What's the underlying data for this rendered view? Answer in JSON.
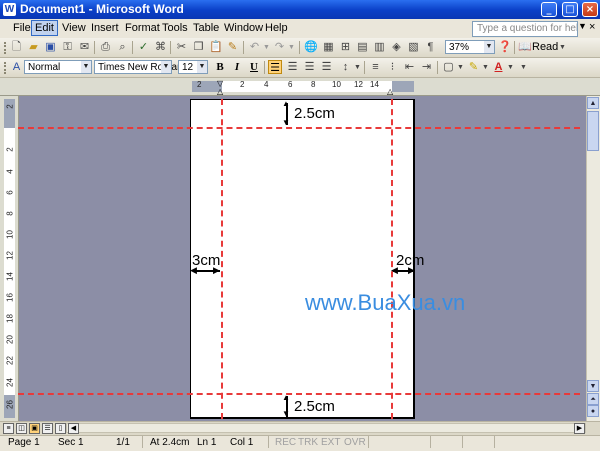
{
  "window": {
    "title": "Document1 - Microsoft Word",
    "app_icon": "W",
    "buttons": {
      "minimize": "_",
      "maximize": "□",
      "close": "×"
    }
  },
  "menu": {
    "items": [
      "File",
      "Edit",
      "View",
      "Insert",
      "Format",
      "Tools",
      "Table",
      "Window",
      "Help"
    ],
    "active": "Edit",
    "help_placeholder": "Type a question for help",
    "close": "×"
  },
  "toolbar_standard": {
    "zoom": "37%",
    "read_label": "Read"
  },
  "toolbar_formatting": {
    "style": "Normal",
    "font": "Times New Roman",
    "size": "12",
    "bold": "B",
    "italic": "I",
    "underline": "U",
    "font_color_label": "A"
  },
  "ruler": {
    "horizontal": [
      "2",
      "2",
      "4",
      "6",
      "8",
      "10",
      "12",
      "14"
    ],
    "vertical": [
      "2",
      "2",
      "4",
      "6",
      "8",
      "10",
      "12",
      "14",
      "16",
      "18",
      "20",
      "22",
      "24",
      "26"
    ]
  },
  "annotations": {
    "top_margin": "2.5cm",
    "bottom_margin": "2.5cm",
    "left_margin": "3cm",
    "right_margin": "2cm",
    "guide_color": "#e83a3a"
  },
  "watermark": "www.BuaXua.vn",
  "status": {
    "page": "Page 1",
    "section": "Sec 1",
    "pages": "1/1",
    "at": "At 2.4cm",
    "line": "Ln 1",
    "col": "Col 1",
    "rec": "REC",
    "trk": "TRK",
    "ext": "EXT",
    "ovr": "OVR"
  }
}
